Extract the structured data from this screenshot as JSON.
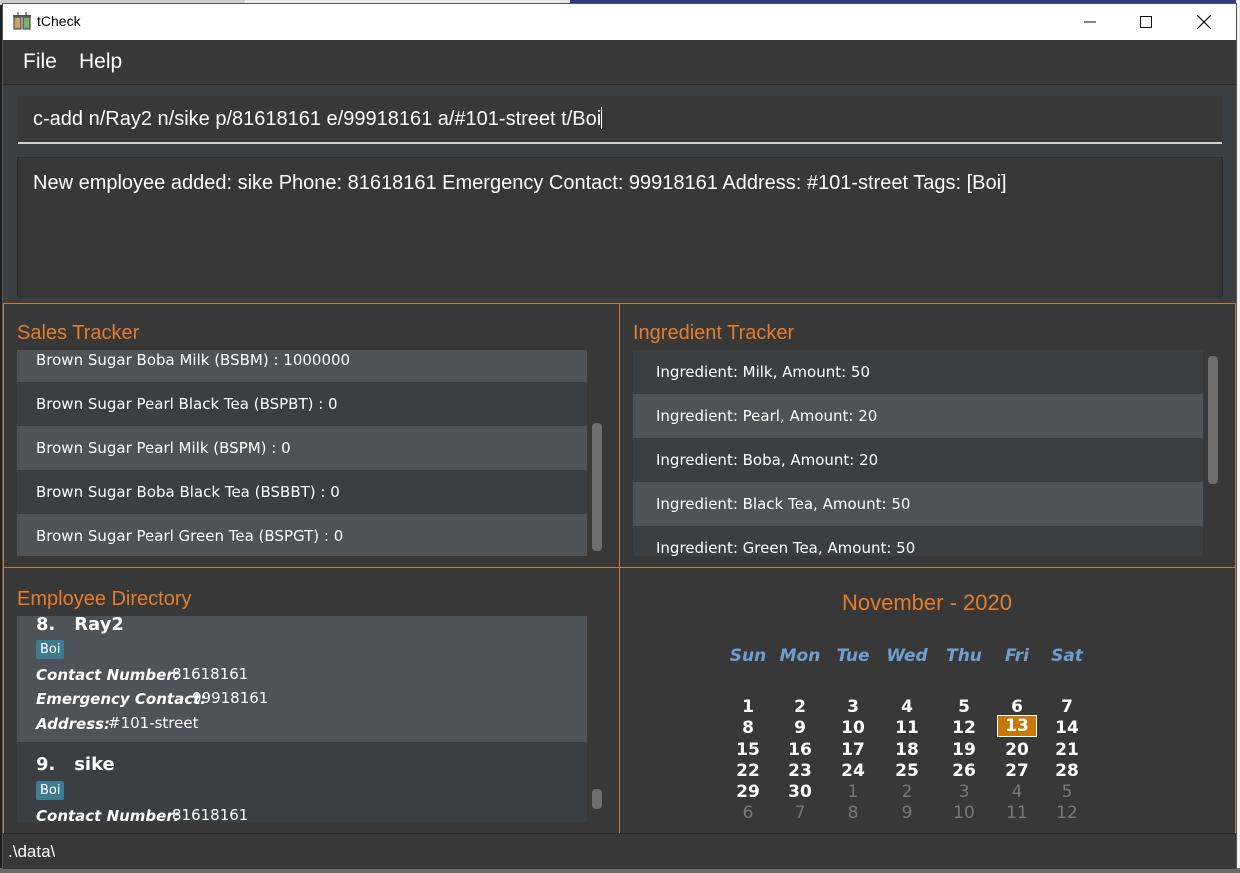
{
  "window": {
    "title": "tCheck"
  },
  "menu": {
    "file": "File",
    "help": "Help"
  },
  "command": {
    "value": "c-add n/Ray2 n/sike p/81618161 e/99918161 a/#101-street t/Boi"
  },
  "result": {
    "text": "New employee added: sike Phone: 81618161 Emergency Contact: 99918161 Address: #101-street Tags: [Boi]"
  },
  "sales": {
    "title": "Sales Tracker",
    "items": [
      "Brown Sugar Boba Milk (BSBM) : 1000000",
      "Brown Sugar Pearl Black Tea (BSPBT) : 0",
      "Brown Sugar Pearl Milk (BSPM) : 0",
      "Brown Sugar Boba Black Tea (BSBBT) : 0",
      "Brown Sugar Pearl Green Tea (BSPGT) : 0"
    ]
  },
  "ingredients": {
    "title": "Ingredient Tracker",
    "items": [
      "Ingredient: Milk,  Amount: 50",
      "Ingredient: Pearl,  Amount: 20",
      "Ingredient: Boba,  Amount: 20",
      "Ingredient: Black Tea,  Amount: 50",
      "Ingredient: Green Tea,  Amount: 50"
    ]
  },
  "employees": {
    "title": "Employee Directory",
    "contact_label": "Contact Number:",
    "emergency_label": "Emergency Contact:",
    "address_label": "Address:",
    "items": [
      {
        "index": "8.",
        "name": "Ray2",
        "tag": "Boi",
        "contact": "81618161",
        "emergency": "99918161",
        "address": "#101-street"
      },
      {
        "index": "9.",
        "name": "sike",
        "tag": "Boi",
        "contact": "81618161"
      }
    ]
  },
  "calendar": {
    "title": "November - 2020",
    "weekdays": [
      "Sun",
      "Mon",
      "Tue",
      "Wed",
      "Thu",
      "Fri",
      "Sat"
    ],
    "weeks": [
      [
        "1",
        "2",
        "3",
        "4",
        "5",
        "6",
        "7"
      ],
      [
        "8",
        "9",
        "10",
        "11",
        "12",
        "13",
        "14"
      ],
      [
        "15",
        "16",
        "17",
        "18",
        "19",
        "20",
        "21"
      ],
      [
        "22",
        "23",
        "24",
        "25",
        "26",
        "27",
        "28"
      ],
      [
        "29",
        "30",
        "1",
        "2",
        "3",
        "4",
        "5"
      ],
      [
        "6",
        "7",
        "8",
        "9",
        "10",
        "11",
        "12"
      ]
    ],
    "today": "13"
  },
  "status": {
    "path": ".\\data\\"
  },
  "colors": {
    "accent": "#e57d2c",
    "panel": "#383838",
    "tag": "#3e7b91",
    "today": "#c77808",
    "weekday": "#6f9fd0"
  },
  "icons": {
    "app": "bubble-tea-app-icon",
    "minimize": "minimize-icon",
    "maximize": "maximize-icon",
    "close": "close-icon"
  }
}
